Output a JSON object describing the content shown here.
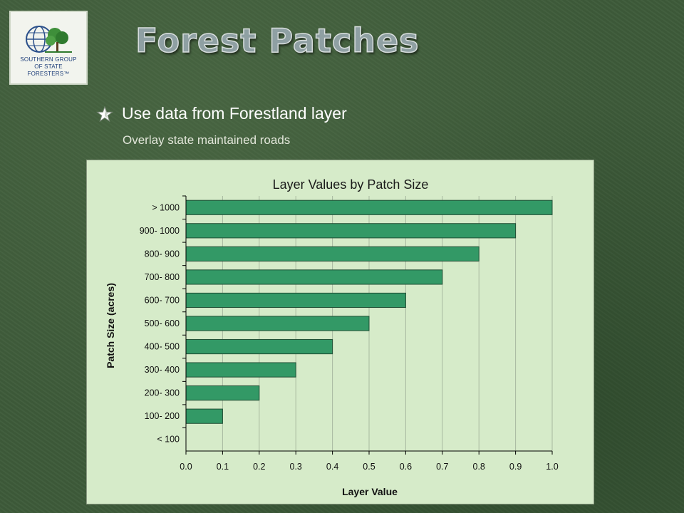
{
  "logo": {
    "line1": "SOUTHERN GROUP",
    "line2": "OF STATE FORESTERS™"
  },
  "slide": {
    "title": "Forest Patches",
    "bullet": "Use data from Forestland layer",
    "sub_bullet": "Overlay state maintained roads"
  },
  "colors": {
    "background": "#3e5b3a",
    "plot_area": "#d6ebc9",
    "bar_fill": "#339966",
    "title_fill": "#8fa0a3"
  },
  "chart_data": {
    "type": "bar",
    "orientation": "horizontal",
    "title": "Layer Values by Patch Size",
    "xlabel": "Layer Value",
    "ylabel": "Patch Size (acres)",
    "xlim": [
      0,
      1
    ],
    "xticks": [
      "0.0",
      "0.1",
      "0.2",
      "0.3",
      "0.4",
      "0.5",
      "0.6",
      "0.7",
      "0.8",
      "0.9",
      "1.0"
    ],
    "grid": "vertical",
    "legend": "none",
    "categories": [
      "< 100",
      "100- 200",
      "200- 300",
      "300- 400",
      "400- 500",
      "500- 600",
      "600- 700",
      "700- 800",
      "800- 900",
      "900- 1000",
      "> 1000"
    ],
    "values": [
      0,
      0.1,
      0.2,
      0.3,
      0.4,
      0.5,
      0.6,
      0.7,
      0.8,
      0.9,
      1.0
    ]
  }
}
